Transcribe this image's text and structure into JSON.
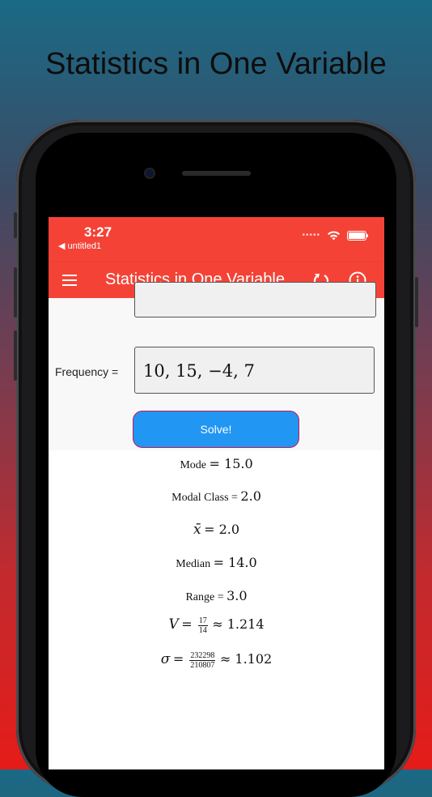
{
  "headline": "Statistics in One Variable",
  "status": {
    "time": "3:27",
    "back_app": "◀ untitled1"
  },
  "appbar": {
    "title": "Statistics in One Variable"
  },
  "form": {
    "frequency_label": "Frequency =",
    "frequency_value": "10, 15, −4, 7",
    "solve_label": "Solve!"
  },
  "results": {
    "mode_label": "Mode",
    "mode_value": "15.0",
    "modal_class_label": "Modal Class",
    "modal_class_value": "2.0",
    "mean_symbol": "x̄",
    "mean_value": "2.0",
    "median_label": "Median",
    "median_value": "14.0",
    "range_label": "Range",
    "range_value": "3.0",
    "variance_symbol": "V",
    "variance_num": "17",
    "variance_den": "14",
    "variance_approx": "1.214",
    "sd_symbol": "σ",
    "sd_num": "232298",
    "sd_den": "210807",
    "sd_approx": "1.102"
  },
  "colors": {
    "appbar": "#f44336",
    "button": "#2196f3"
  }
}
